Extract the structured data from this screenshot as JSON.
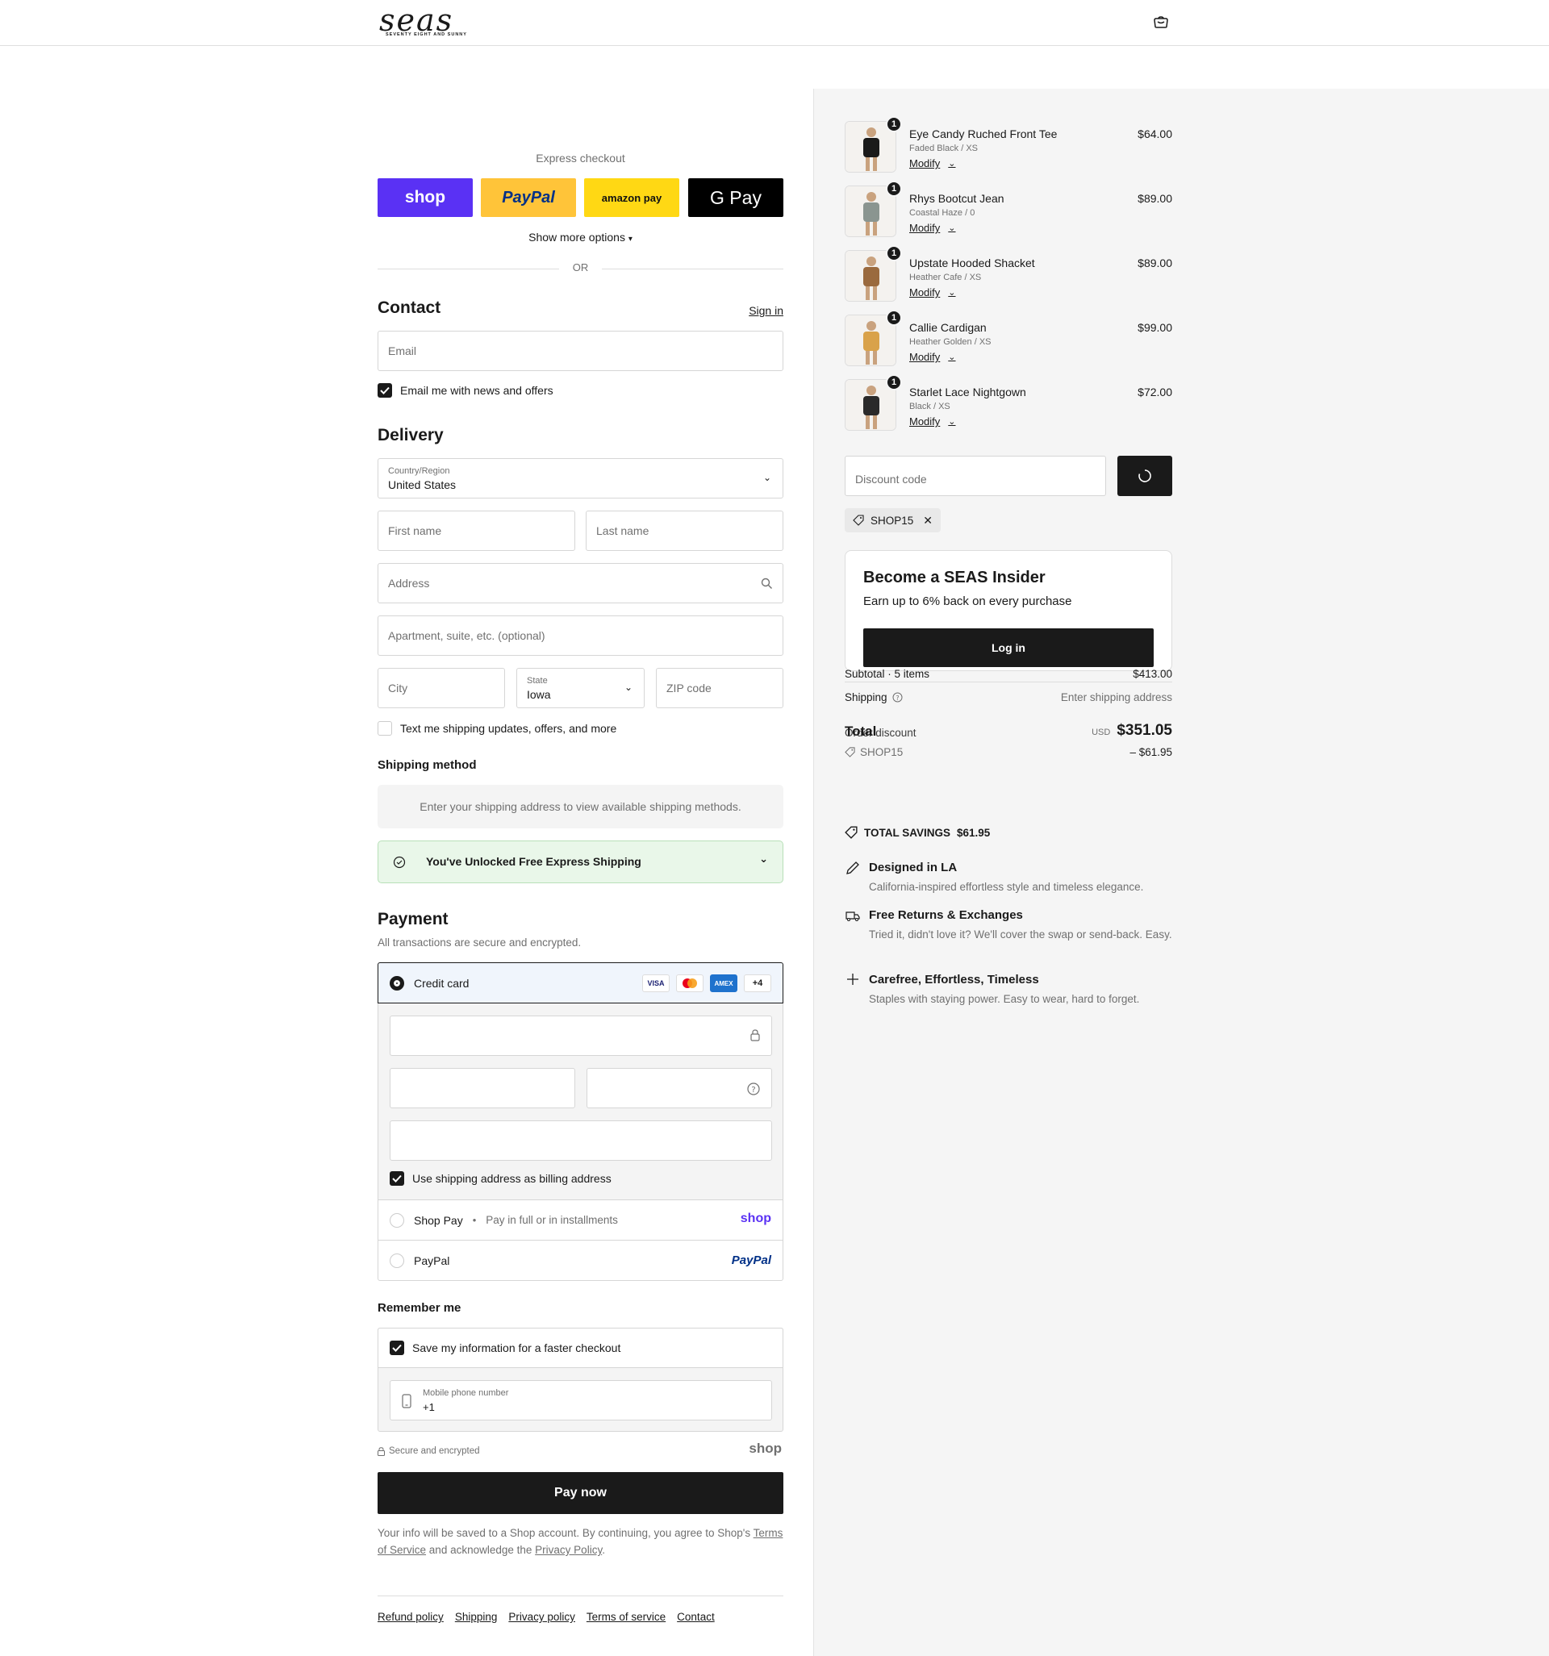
{
  "header": {
    "logo_word": "seas",
    "logo_tagline": "SEVENTY EIGHT AND SUNNY"
  },
  "express": {
    "title": "Express checkout",
    "buttons": [
      {
        "label": "shop",
        "bg": "#5a31f4",
        "fg": "#ffffff"
      },
      {
        "label": "PayPal",
        "bg": "#ffc439",
        "fg": "#003087"
      },
      {
        "label": "amazon pay",
        "bg": "#ffd814",
        "fg": "#111111"
      },
      {
        "label": "G Pay",
        "bg": "#000000",
        "fg": "#ffffff"
      }
    ],
    "more_options": "Show more options",
    "or_label": "OR"
  },
  "contact": {
    "heading": "Contact",
    "sign_in": "Sign in",
    "email_placeholder": "Email",
    "newsletter_label": "Email me with news and offers"
  },
  "delivery": {
    "heading": "Delivery",
    "country_label": "Country/Region",
    "country_value": "United States",
    "first_name": "First name",
    "last_name": "Last name",
    "address": "Address",
    "apartment": "Apartment, suite, etc. (optional)",
    "city": "City",
    "state_label": "State",
    "state_value": "Iowa",
    "zip": "ZIP code",
    "sms_label": "Text me shipping updates, offers, and more"
  },
  "shipping_method": {
    "heading": "Shipping method",
    "notice": "Enter your shipping address to view available shipping methods.",
    "promo": "You've Unlocked Free Express Shipping"
  },
  "payment": {
    "heading": "Payment",
    "subtitle": "All transactions are secure and encrypted.",
    "credit_card_label": "Credit card",
    "card_brands": [
      "VISA",
      "MC",
      "AMEX"
    ],
    "more_brands": "+4",
    "billing_label": "Use shipping address as billing address",
    "shop_pay_label": "Shop Pay",
    "shop_pay_sub": "Pay in full or in installments",
    "shop_pay_logo": "shop",
    "paypal_label": "PayPal",
    "paypal_logo": "PayPal"
  },
  "remember": {
    "heading": "Remember me",
    "save_label": "Save my information for a faster checkout",
    "phone_label": "Mobile phone number",
    "phone_value": "+1",
    "secure_label": "Secure and encrypted",
    "shop_logo": "shop"
  },
  "pay_now": "Pay now",
  "legal": {
    "text_before": "Your info will be saved to a Shop account. By continuing, you agree to Shop's",
    "terms": "Terms of Service",
    "and": "and acknowledge the",
    "privacy": "Privacy Policy",
    "period": "."
  },
  "footer_links": [
    "Refund policy",
    "Shipping",
    "Privacy policy",
    "Terms of service",
    "Contact"
  ],
  "cart": {
    "items": [
      {
        "name": "Eye Candy Ruched Front Tee",
        "variant": "Faded Black / XS",
        "modify": "Modify",
        "price": "$64.00",
        "qty": "1",
        "color": "#1a1a1a"
      },
      {
        "name": "Rhys Bootcut Jean",
        "variant": "Coastal Haze / 0",
        "modify": "Modify",
        "price": "$89.00",
        "qty": "1",
        "color": "#8a9590"
      },
      {
        "name": "Upstate Hooded Shacket",
        "variant": "Heather Cafe / XS",
        "modify": "Modify",
        "price": "$89.00",
        "qty": "1",
        "color": "#9a6a3e"
      },
      {
        "name": "Callie Cardigan",
        "variant": "Heather Golden / XS",
        "modify": "Modify",
        "price": "$99.00",
        "qty": "1",
        "color": "#d9a24a"
      },
      {
        "name": "Starlet Lace Nightgown",
        "variant": "Black / XS",
        "modify": "Modify",
        "price": "$72.00",
        "qty": "1",
        "color": "#2a2a2a"
      }
    ],
    "discount_placeholder": "Discount code",
    "applied_code": "SHOP15"
  },
  "insider": {
    "title": "Become a SEAS Insider",
    "subtitle": "Earn up to 6% back on every purchase",
    "login": "Log in"
  },
  "summary": {
    "subtotal_label": "Subtotal · 5 items",
    "subtotal_value": "$413.00",
    "shipping_label": "Shipping",
    "shipping_value": "Enter shipping address",
    "total_label": "Total",
    "order_discount_label": "Order discount",
    "currency": "USD",
    "total_value": "$351.05",
    "discount_code": "SHOP15",
    "discount_value": "– $61.95"
  },
  "savings": {
    "label": "TOTAL SAVINGS",
    "value": "$61.95"
  },
  "features": [
    {
      "title": "Designed in LA",
      "desc": "California-inspired effortless style and timeless elegance."
    },
    {
      "title": "Free Returns & Exchanges",
      "desc": "Tried it, didn't love it? We'll cover the swap or send-back. Easy."
    },
    {
      "title": "Carefree, Effortless, Timeless",
      "desc": "Staples with staying power. Easy to wear, hard to forget."
    }
  ]
}
